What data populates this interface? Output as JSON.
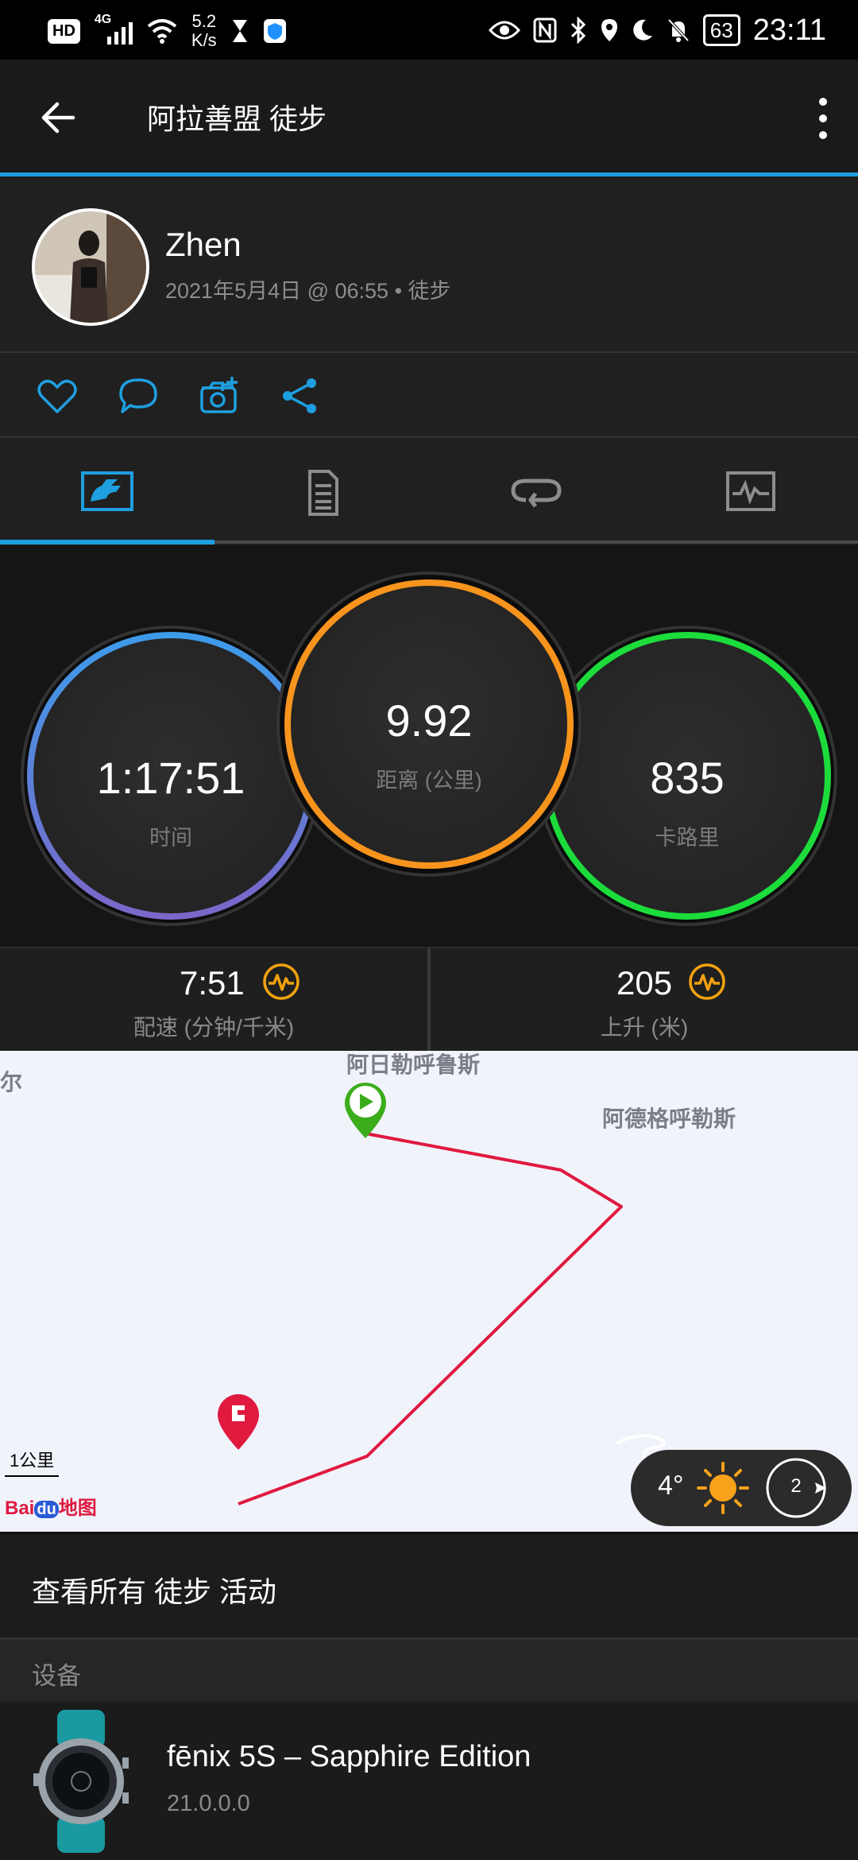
{
  "status_bar": {
    "net_speed_value": "5.2",
    "net_speed_unit": "K/s",
    "hd_badge": "HD",
    "network": "4G",
    "battery": "63",
    "time": "23:11"
  },
  "app_bar": {
    "title": "阿拉善盟 徒步"
  },
  "profile": {
    "name": "Zhen",
    "meta": "2021年5月4日 @ 06:55 • 徒步"
  },
  "colors": {
    "accent": "#1e9fe0",
    "ring_time_start": "#3d9be9",
    "ring_time_end": "#7b67c9",
    "ring_distance": "#f7941d",
    "ring_calories": "#1cdc3c",
    "badge": "#f2a20f",
    "route": "#e0193f"
  },
  "stats": {
    "time": {
      "value": "1:17:51",
      "label": "时间"
    },
    "distance": {
      "value": "9.92",
      "label": "距离 (公里)"
    },
    "calories": {
      "value": "835",
      "label": "卡路里"
    },
    "pace": {
      "value": "7:51",
      "label": "配速 (分钟/千米)",
      "icon": "pulse-badge-icon"
    },
    "ascent": {
      "value": "205",
      "label": "上升 (米)",
      "icon": "pulse-badge-icon"
    }
  },
  "map": {
    "labels": {
      "left": "尔",
      "top": "阿日勒呼鲁斯",
      "right": "阿德格呼勒斯"
    },
    "scale": "1公里",
    "provider": {
      "part1": "Bai",
      "part2": "du",
      "part3": "地图"
    },
    "weather": {
      "temp": "4°",
      "wind": "2"
    }
  },
  "view_all": "查看所有 徒步 活动",
  "devices": {
    "header": "设备",
    "name": "fēnix 5S – Sapphire Edition",
    "version": "21.0.0.0"
  }
}
